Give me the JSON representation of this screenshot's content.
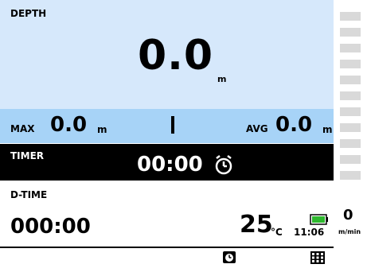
{
  "depth": {
    "label": "DEPTH",
    "value": "0.0",
    "unit": "m"
  },
  "max": {
    "label": "MAX",
    "value": "0.0",
    "unit": "m"
  },
  "avg": {
    "label": "AVG",
    "value": "0.0",
    "unit": "m"
  },
  "timer": {
    "label": "TIMER",
    "value": "00:00",
    "icon": "stopwatch-icon"
  },
  "dive_time": {
    "label": "D-TIME",
    "value": "000:00"
  },
  "temperature": {
    "value": "25",
    "unit": "°C"
  },
  "clock": "11:06",
  "battery": {
    "icon": "battery-icon",
    "color": "#2eb82e"
  },
  "ascent_rate": {
    "value": "0",
    "unit": "m/min"
  },
  "bottom_buttons": [
    {
      "icon": "stopwatch-button-icon"
    },
    {
      "icon": "grid-menu-icon"
    }
  ],
  "colors": {
    "depth_bg": "#d6e8fb",
    "stats_bg": "#a7d3f7",
    "timer_bg": "#000000",
    "scale": "#d9d9d9"
  }
}
